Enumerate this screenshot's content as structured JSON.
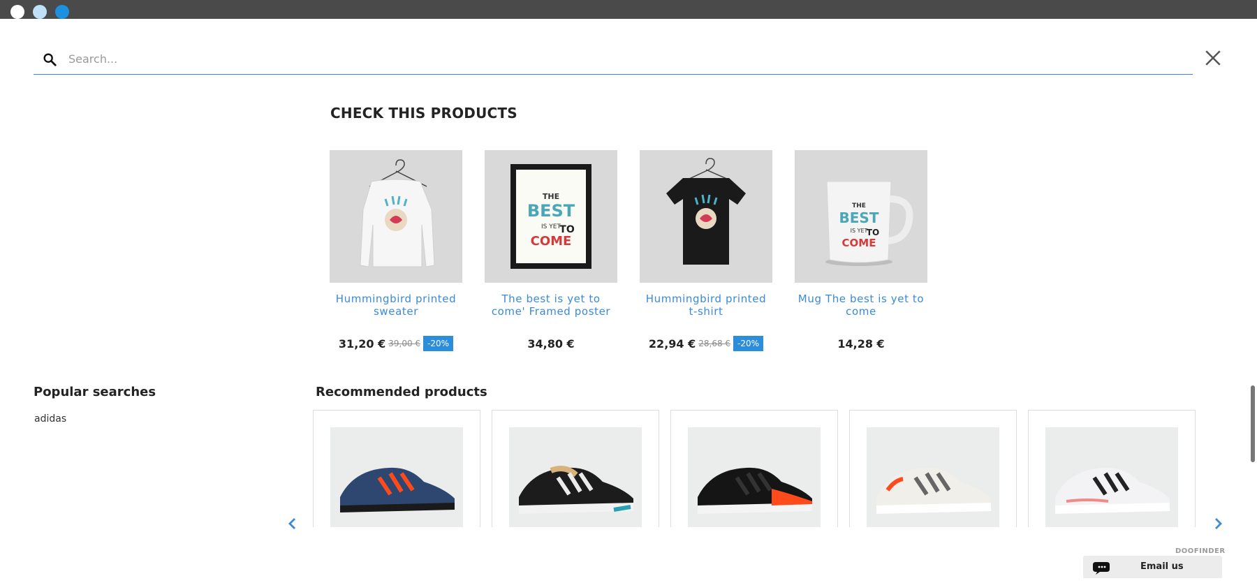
{
  "search": {
    "placeholder": "Search...",
    "value": ""
  },
  "featured": {
    "title": "CHECK THIS PRODUCTS",
    "products": [
      {
        "name": "Hummingbird printed sweater",
        "price": "31,20 €",
        "old_price": "39,00 €",
        "discount": "-20%"
      },
      {
        "name": "The best is yet to come' Framed poster",
        "price": "34,80 €"
      },
      {
        "name": "Hummingbird printed t-shirt",
        "price": "22,94 €",
        "old_price": "28,68 €",
        "discount": "-20%"
      },
      {
        "name": "Mug The best is yet to come",
        "price": "14,28 €"
      }
    ],
    "poster_text": {
      "the": "THE",
      "best": "BEST",
      "is_yet": "IS YET",
      "to": "TO",
      "come": "COME"
    }
  },
  "popular": {
    "title": "Popular searches",
    "items": [
      "adidas"
    ]
  },
  "recommended": {
    "title": "Recommended products"
  },
  "footer": {
    "brand": "DOOFINDER",
    "email_label": "Email us"
  },
  "colors": {
    "accent": "#3a8ad8",
    "discount_bg": "#2c8ddb",
    "topbar": "#4a4a4a"
  },
  "icons": [
    "search-icon",
    "close-icon",
    "chevron-left-icon",
    "chevron-right-icon",
    "chat-icon"
  ]
}
